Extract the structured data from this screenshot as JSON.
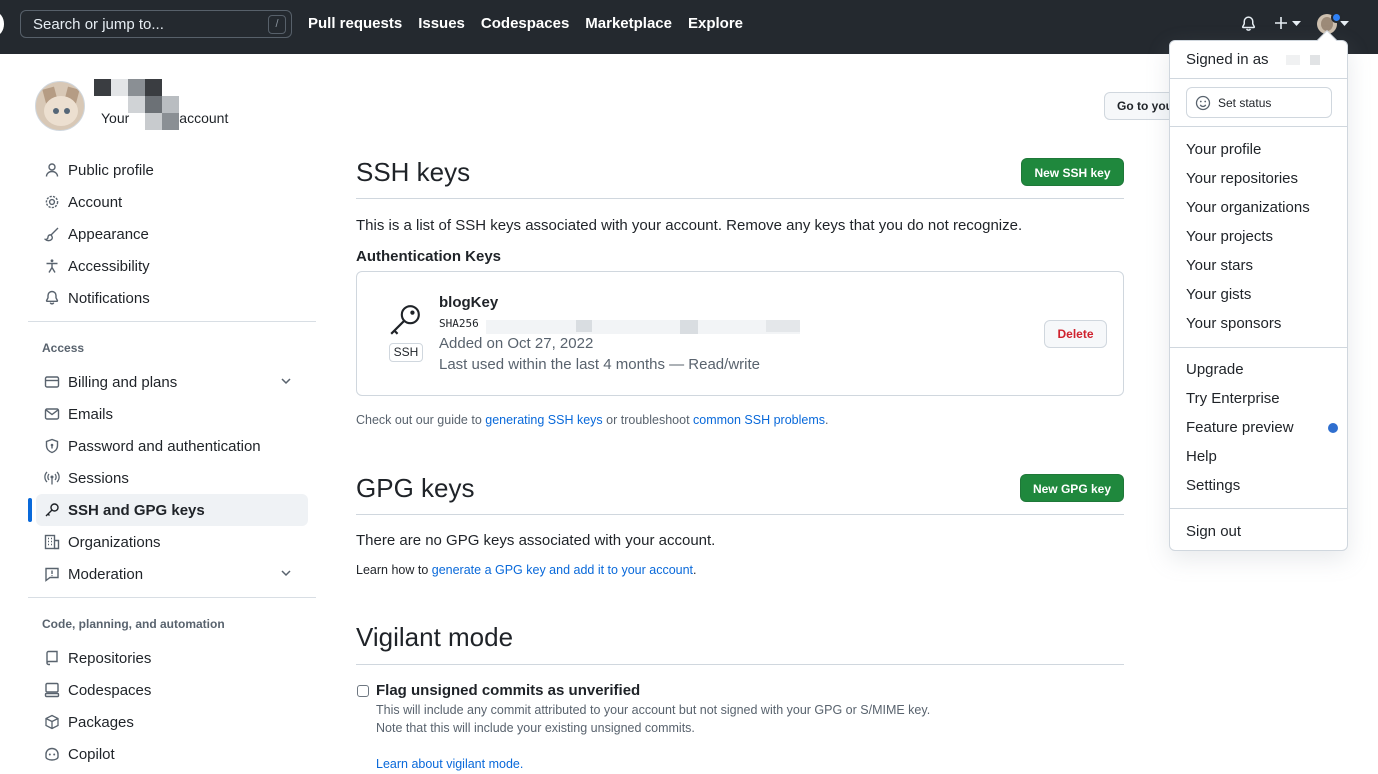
{
  "header": {
    "search_placeholder": "Search or jump to...",
    "search_shortcut": "/",
    "nav": [
      "Pull requests",
      "Issues",
      "Codespaces",
      "Marketplace",
      "Explore"
    ]
  },
  "profile": {
    "subtitle_left": "Your",
    "subtitle_right": "account",
    "go_to_profile": "Go to your personal profile"
  },
  "sidebar": {
    "top_items": [
      {
        "label": "Public profile",
        "icon": "person-icon"
      },
      {
        "label": "Account",
        "icon": "gear-icon"
      },
      {
        "label": "Appearance",
        "icon": "paintbrush-icon"
      },
      {
        "label": "Accessibility",
        "icon": "accessibility-icon"
      },
      {
        "label": "Notifications",
        "icon": "bell-icon"
      }
    ],
    "access_heading": "Access",
    "access_items": [
      {
        "label": "Billing and plans",
        "icon": "credit-card-icon"
      },
      {
        "label": "Emails",
        "icon": "mail-icon"
      },
      {
        "label": "Password and authentication",
        "icon": "shield-lock-icon"
      },
      {
        "label": "Sessions",
        "icon": "broadcast-icon"
      },
      {
        "label": "SSH and GPG keys",
        "icon": "key-icon"
      },
      {
        "label": "Organizations",
        "icon": "organization-icon"
      },
      {
        "label": "Moderation",
        "icon": "report-icon"
      }
    ],
    "code_heading": "Code, planning, and automation",
    "code_items": [
      {
        "label": "Repositories",
        "icon": "repo-icon"
      },
      {
        "label": "Codespaces",
        "icon": "codespaces-icon"
      },
      {
        "label": "Packages",
        "icon": "package-icon"
      },
      {
        "label": "Copilot",
        "icon": "copilot-icon"
      }
    ]
  },
  "ssh": {
    "title": "SSH keys",
    "new_button": "New SSH key",
    "description": "This is a list of SSH keys associated with your account. Remove any keys that you do not recognize.",
    "auth_heading": "Authentication Keys",
    "key": {
      "title": "blogKey",
      "fingerprint_prefix": "SHA256",
      "badge": "SSH",
      "added": "Added on Oct 27, 2022",
      "last_used": "Last used within the last 4 months — Read/write",
      "delete": "Delete"
    },
    "guide": {
      "pre": "Check out our guide to ",
      "link1": "generating SSH keys",
      "mid": " or troubleshoot ",
      "link2": "common SSH problems",
      "post": "."
    }
  },
  "gpg": {
    "title": "GPG keys",
    "new_button": "New GPG key",
    "empty": "There are no GPG keys associated with your account.",
    "learn_pre": "Learn how to ",
    "learn_link": "generate a GPG key and add it to your account",
    "learn_post": "."
  },
  "vigilant": {
    "title": "Vigilant mode",
    "checkbox_label": "Flag unsigned commits as unverified",
    "line1": "This will include any commit attributed to your account but not signed with your GPG or S/MIME key.",
    "line2": "Note that this will include your existing unsigned commits.",
    "learn": "Learn about vigilant mode."
  },
  "dropdown": {
    "signed_in": "Signed in as",
    "set_status": "Set status",
    "group1": [
      "Your profile",
      "Your repositories",
      "Your organizations",
      "Your projects",
      "Your stars",
      "Your gists",
      "Your sponsors"
    ],
    "group2": [
      "Upgrade",
      "Try Enterprise",
      "Feature preview",
      "Help",
      "Settings"
    ],
    "sign_out": "Sign out"
  },
  "colors": {
    "header_bg": "#24292f",
    "primary_green": "#1f883d",
    "link_blue": "#0969da",
    "active_indicator": "#0969da",
    "danger": "#cf222e"
  }
}
